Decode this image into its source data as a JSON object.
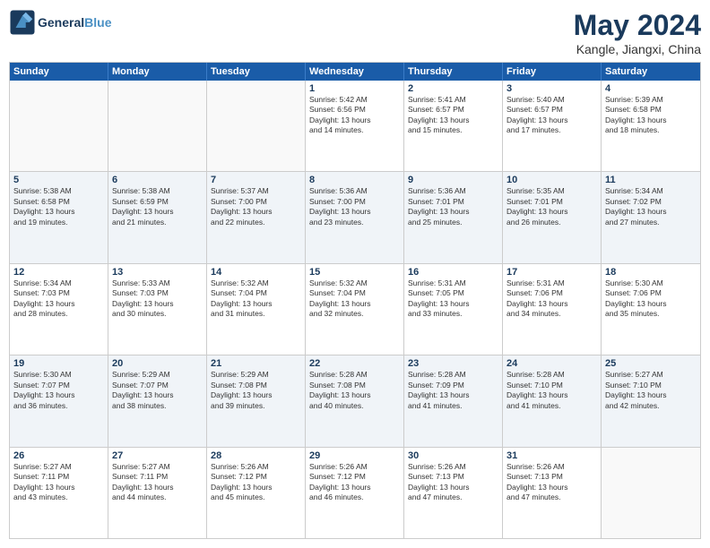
{
  "header": {
    "logo_line1": "General",
    "logo_line2": "Blue",
    "month_title": "May 2024",
    "location": "Kangle, Jiangxi, China"
  },
  "day_headers": [
    "Sunday",
    "Monday",
    "Tuesday",
    "Wednesday",
    "Thursday",
    "Friday",
    "Saturday"
  ],
  "weeks": [
    [
      {
        "day": "",
        "info": ""
      },
      {
        "day": "",
        "info": ""
      },
      {
        "day": "",
        "info": ""
      },
      {
        "day": "1",
        "info": "Sunrise: 5:42 AM\nSunset: 6:56 PM\nDaylight: 13 hours\nand 14 minutes."
      },
      {
        "day": "2",
        "info": "Sunrise: 5:41 AM\nSunset: 6:57 PM\nDaylight: 13 hours\nand 15 minutes."
      },
      {
        "day": "3",
        "info": "Sunrise: 5:40 AM\nSunset: 6:57 PM\nDaylight: 13 hours\nand 17 minutes."
      },
      {
        "day": "4",
        "info": "Sunrise: 5:39 AM\nSunset: 6:58 PM\nDaylight: 13 hours\nand 18 minutes."
      }
    ],
    [
      {
        "day": "5",
        "info": "Sunrise: 5:38 AM\nSunset: 6:58 PM\nDaylight: 13 hours\nand 19 minutes."
      },
      {
        "day": "6",
        "info": "Sunrise: 5:38 AM\nSunset: 6:59 PM\nDaylight: 13 hours\nand 21 minutes."
      },
      {
        "day": "7",
        "info": "Sunrise: 5:37 AM\nSunset: 7:00 PM\nDaylight: 13 hours\nand 22 minutes."
      },
      {
        "day": "8",
        "info": "Sunrise: 5:36 AM\nSunset: 7:00 PM\nDaylight: 13 hours\nand 23 minutes."
      },
      {
        "day": "9",
        "info": "Sunrise: 5:36 AM\nSunset: 7:01 PM\nDaylight: 13 hours\nand 25 minutes."
      },
      {
        "day": "10",
        "info": "Sunrise: 5:35 AM\nSunset: 7:01 PM\nDaylight: 13 hours\nand 26 minutes."
      },
      {
        "day": "11",
        "info": "Sunrise: 5:34 AM\nSunset: 7:02 PM\nDaylight: 13 hours\nand 27 minutes."
      }
    ],
    [
      {
        "day": "12",
        "info": "Sunrise: 5:34 AM\nSunset: 7:03 PM\nDaylight: 13 hours\nand 28 minutes."
      },
      {
        "day": "13",
        "info": "Sunrise: 5:33 AM\nSunset: 7:03 PM\nDaylight: 13 hours\nand 30 minutes."
      },
      {
        "day": "14",
        "info": "Sunrise: 5:32 AM\nSunset: 7:04 PM\nDaylight: 13 hours\nand 31 minutes."
      },
      {
        "day": "15",
        "info": "Sunrise: 5:32 AM\nSunset: 7:04 PM\nDaylight: 13 hours\nand 32 minutes."
      },
      {
        "day": "16",
        "info": "Sunrise: 5:31 AM\nSunset: 7:05 PM\nDaylight: 13 hours\nand 33 minutes."
      },
      {
        "day": "17",
        "info": "Sunrise: 5:31 AM\nSunset: 7:06 PM\nDaylight: 13 hours\nand 34 minutes."
      },
      {
        "day": "18",
        "info": "Sunrise: 5:30 AM\nSunset: 7:06 PM\nDaylight: 13 hours\nand 35 minutes."
      }
    ],
    [
      {
        "day": "19",
        "info": "Sunrise: 5:30 AM\nSunset: 7:07 PM\nDaylight: 13 hours\nand 36 minutes."
      },
      {
        "day": "20",
        "info": "Sunrise: 5:29 AM\nSunset: 7:07 PM\nDaylight: 13 hours\nand 38 minutes."
      },
      {
        "day": "21",
        "info": "Sunrise: 5:29 AM\nSunset: 7:08 PM\nDaylight: 13 hours\nand 39 minutes."
      },
      {
        "day": "22",
        "info": "Sunrise: 5:28 AM\nSunset: 7:08 PM\nDaylight: 13 hours\nand 40 minutes."
      },
      {
        "day": "23",
        "info": "Sunrise: 5:28 AM\nSunset: 7:09 PM\nDaylight: 13 hours\nand 41 minutes."
      },
      {
        "day": "24",
        "info": "Sunrise: 5:28 AM\nSunset: 7:10 PM\nDaylight: 13 hours\nand 41 minutes."
      },
      {
        "day": "25",
        "info": "Sunrise: 5:27 AM\nSunset: 7:10 PM\nDaylight: 13 hours\nand 42 minutes."
      }
    ],
    [
      {
        "day": "26",
        "info": "Sunrise: 5:27 AM\nSunset: 7:11 PM\nDaylight: 13 hours\nand 43 minutes."
      },
      {
        "day": "27",
        "info": "Sunrise: 5:27 AM\nSunset: 7:11 PM\nDaylight: 13 hours\nand 44 minutes."
      },
      {
        "day": "28",
        "info": "Sunrise: 5:26 AM\nSunset: 7:12 PM\nDaylight: 13 hours\nand 45 minutes."
      },
      {
        "day": "29",
        "info": "Sunrise: 5:26 AM\nSunset: 7:12 PM\nDaylight: 13 hours\nand 46 minutes."
      },
      {
        "day": "30",
        "info": "Sunrise: 5:26 AM\nSunset: 7:13 PM\nDaylight: 13 hours\nand 47 minutes."
      },
      {
        "day": "31",
        "info": "Sunrise: 5:26 AM\nSunset: 7:13 PM\nDaylight: 13 hours\nand 47 minutes."
      },
      {
        "day": "",
        "info": ""
      }
    ]
  ]
}
